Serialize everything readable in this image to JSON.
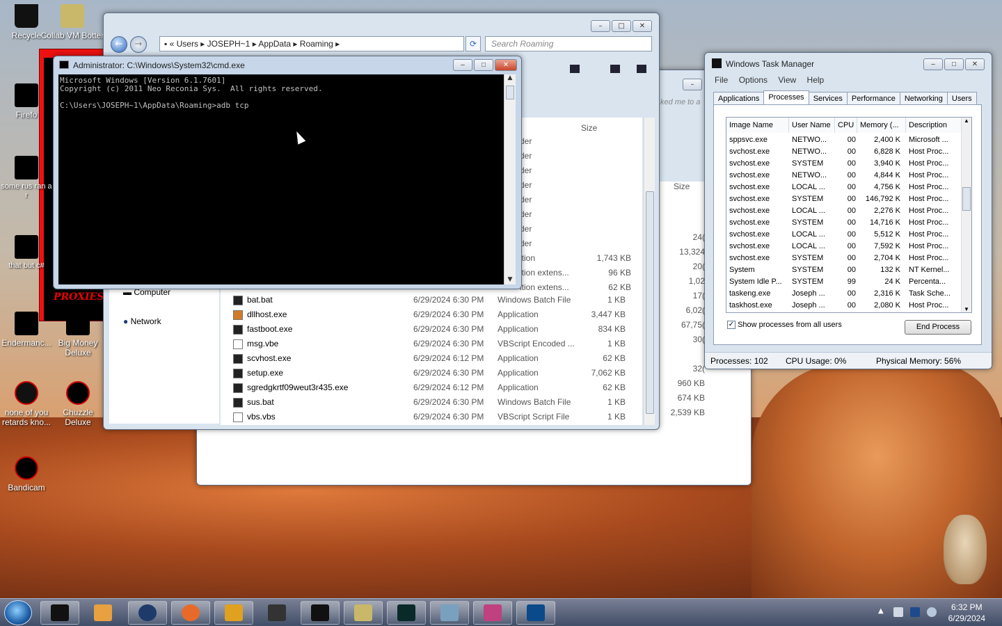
{
  "desktop": {
    "icons": [
      {
        "label": "Recycle"
      },
      {
        "label": "Collab VM Botter"
      },
      {
        "label": "Firefo"
      },
      {
        "label": "some rus ran a r"
      },
      {
        "label": "that but c#"
      },
      {
        "label": "Endermanc..."
      },
      {
        "label": "Big Money Deluxe"
      },
      {
        "label": "none of you retards kno..."
      },
      {
        "label": "Chuzzle Deluxe"
      },
      {
        "label": "Bandicam"
      }
    ],
    "proxies_text": "PROXIES"
  },
  "explorer": {
    "breadcrumb": [
      "Users",
      "JOSEPH~1",
      "AppData",
      "Roaming"
    ],
    "search_placeholder": "Search Roaming",
    "size_header": "Size",
    "nav_items": [
      {
        "label": "Computer"
      },
      {
        "label": "Network"
      }
    ],
    "partial_rows": [
      {
        "type": "der",
        "size": ""
      },
      {
        "type": "der",
        "size": ""
      },
      {
        "type": "der",
        "size": ""
      },
      {
        "type": "der",
        "size": ""
      },
      {
        "type": "der",
        "size": ""
      },
      {
        "type": "der",
        "size": ""
      },
      {
        "type": "der",
        "size": ""
      },
      {
        "type": "der",
        "size": ""
      },
      {
        "type": "ition",
        "size": "1,743 KB"
      },
      {
        "type": "ition extens...",
        "size": "96 KB"
      },
      {
        "type": "ition extens...",
        "size": "62 KB"
      }
    ],
    "files": [
      {
        "name": "bat.bat",
        "date": "6/29/2024 6:30 PM",
        "type": "Windows Batch File",
        "size": "1 KB"
      },
      {
        "name": "dllhost.exe",
        "date": "6/29/2024 6:30 PM",
        "type": "Application",
        "size": "3,447 KB"
      },
      {
        "name": "fastboot.exe",
        "date": "6/29/2024 6:30 PM",
        "type": "Application",
        "size": "834 KB"
      },
      {
        "name": "msg.vbe",
        "date": "6/29/2024 6:30 PM",
        "type": "VBScript Encoded ...",
        "size": "1 KB"
      },
      {
        "name": "scvhost.exe",
        "date": "6/29/2024 6:12 PM",
        "type": "Application",
        "size": "62 KB"
      },
      {
        "name": "setup.exe",
        "date": "6/29/2024 6:30 PM",
        "type": "Application",
        "size": "7,062 KB"
      },
      {
        "name": "sgredgkrtf09weut3r435.exe",
        "date": "6/29/2024 6:12 PM",
        "type": "Application",
        "size": "62 KB"
      },
      {
        "name": "sus.bat",
        "date": "6/29/2024 6:30 PM",
        "type": "Windows Batch File",
        "size": "1 KB"
      },
      {
        "name": "vbs.vbs",
        "date": "6/29/2024 6:30 PM",
        "type": "VBScript Script File",
        "size": "1 KB"
      }
    ]
  },
  "back_window": {
    "search_fragment": "ked me to a",
    "size_header": "Size",
    "sizes": [
      "24(",
      "13,324",
      "20(",
      "1,02",
      "17(",
      "6,02(",
      "67,75(",
      "30(",
      "32(",
      "960 KB",
      "674 KB",
      "2,539 KB"
    ]
  },
  "cmd": {
    "title": "Administrator: C:\\Windows\\System32\\cmd.exe",
    "lines": [
      "Microsoft Windows [Version 6.1.7601]",
      "Copyright (c) 2011 Neo Reconia Sys.  All rights reserved.",
      "",
      "C:\\Users\\JOSEPH~1\\AppData\\Roaming>adb tcp"
    ]
  },
  "taskmgr": {
    "title": "Windows Task Manager",
    "menu": [
      "File",
      "Options",
      "View",
      "Help"
    ],
    "tabs": [
      "Applications",
      "Processes",
      "Services",
      "Performance",
      "Networking",
      "Users"
    ],
    "active_tab": "Processes",
    "columns": [
      "Image Name",
      "User Name",
      "CPU",
      "Memory (...",
      "Description"
    ],
    "rows": [
      [
        "sppsvc.exe",
        "NETWO...",
        "00",
        "2,400 K",
        "Microsoft ..."
      ],
      [
        "svchost.exe",
        "NETWO...",
        "00",
        "6,828 K",
        "Host Proc..."
      ],
      [
        "svchost.exe",
        "SYSTEM",
        "00",
        "3,940 K",
        "Host Proc..."
      ],
      [
        "svchost.exe",
        "NETWO...",
        "00",
        "4,844 K",
        "Host Proc..."
      ],
      [
        "svchost.exe",
        "LOCAL ...",
        "00",
        "4,756 K",
        "Host Proc..."
      ],
      [
        "svchost.exe",
        "SYSTEM",
        "00",
        "146,792 K",
        "Host Proc..."
      ],
      [
        "svchost.exe",
        "LOCAL ...",
        "00",
        "2,276 K",
        "Host Proc..."
      ],
      [
        "svchost.exe",
        "SYSTEM",
        "00",
        "14,716 K",
        "Host Proc..."
      ],
      [
        "svchost.exe",
        "LOCAL ...",
        "00",
        "5,512 K",
        "Host Proc..."
      ],
      [
        "svchost.exe",
        "LOCAL ...",
        "00",
        "7,592 K",
        "Host Proc..."
      ],
      [
        "svchost.exe",
        "SYSTEM",
        "00",
        "2,704 K",
        "Host Proc..."
      ],
      [
        "System",
        "SYSTEM",
        "00",
        "132 K",
        "NT Kernel..."
      ],
      [
        "System Idle P...",
        "SYSTEM",
        "99",
        "24 K",
        "Percenta..."
      ],
      [
        "taskeng.exe",
        "Joseph ...",
        "00",
        "2,316 K",
        "Task Sche..."
      ],
      [
        "taskhost.exe",
        "Joseph ...",
        "00",
        "2,080 K",
        "Host Proc..."
      ]
    ],
    "show_all_label": "Show processes from all users",
    "show_all_checked": true,
    "end_process_label": "End Process",
    "status": {
      "processes": "Processes: 102",
      "cpu": "CPU Usage: 0%",
      "memory": "Physical Memory: 56%"
    }
  },
  "taskbar": {
    "clock_time": "6:32 PM",
    "clock_date": "6/29/2024"
  }
}
